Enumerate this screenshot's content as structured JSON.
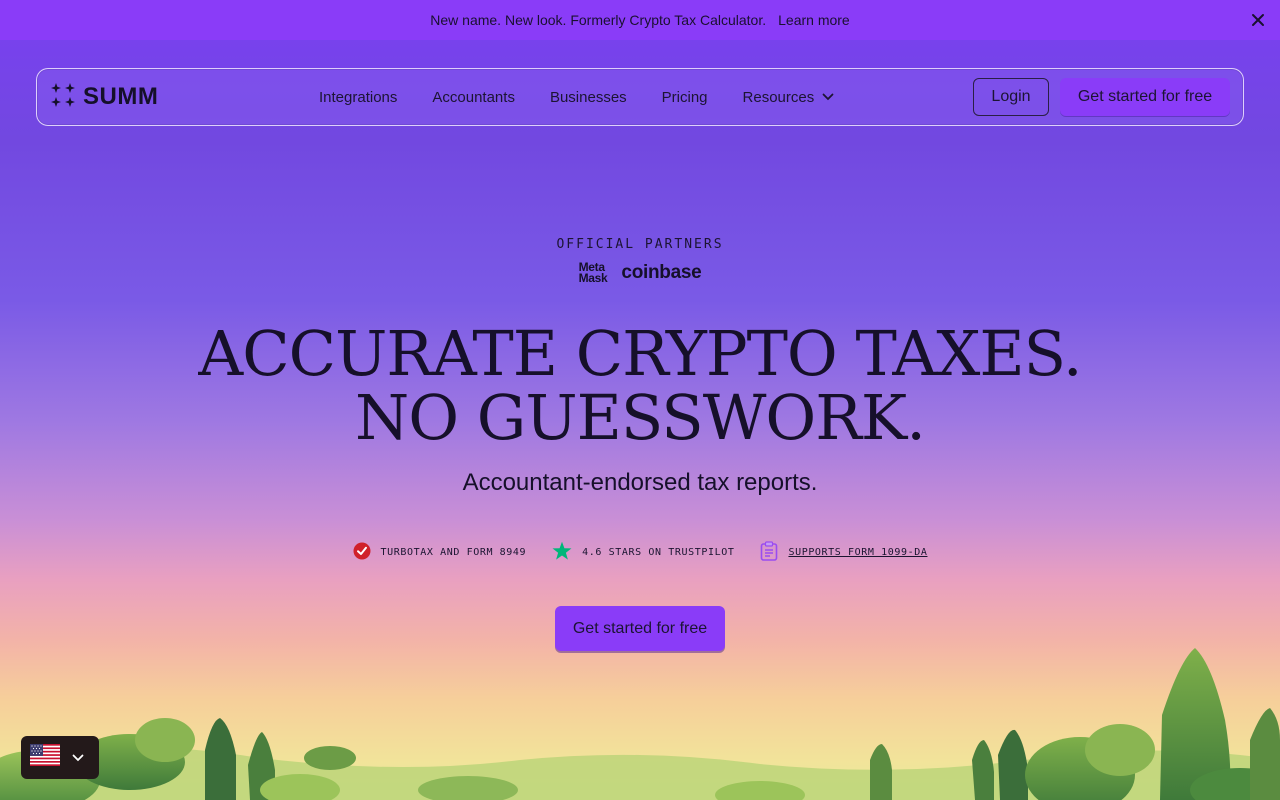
{
  "announcement": {
    "text": "New name. New look. Formerly Crypto Tax Calculator.",
    "link": "Learn more",
    "close_icon": "close-icon"
  },
  "nav": {
    "brand": "SUMM",
    "links": [
      {
        "label": "Integrations"
      },
      {
        "label": "Accountants"
      },
      {
        "label": "Businesses"
      },
      {
        "label": "Pricing"
      },
      {
        "label": "Resources",
        "icon": "chevron-down-icon"
      }
    ],
    "login": "Login",
    "cta": "Get started for free"
  },
  "hero": {
    "partners_label": "OFFICIAL PARTNERS",
    "partners": {
      "metamask_line1": "Meta",
      "metamask_line2": "Mask",
      "coinbase": "coinbase"
    },
    "headline_line1": "ACCURATE CRYPTO TAXES.",
    "headline_line2": "NO GUESSWORK.",
    "subheadline": "Accountant-endorsed tax reports.",
    "badges": [
      {
        "icon": "check-circle-icon",
        "text": "TURBOTAX AND FORM 8949"
      },
      {
        "icon": "star-icon",
        "text": "4.6 STARS ON TRUSTPILOT"
      },
      {
        "icon": "clipboard-icon",
        "text": "SUPPORTS FORM 1099-DA"
      }
    ],
    "cta": "Get started for free"
  },
  "locale": {
    "flag": "us-flag-icon",
    "icon": "chevron-down-icon"
  },
  "colors": {
    "accent": "#8a3cf8",
    "announcement_bg": "#8a3cf8",
    "text": "#16102a",
    "turbotax_red": "#d0212a",
    "trustpilot_green": "#00b67a"
  }
}
